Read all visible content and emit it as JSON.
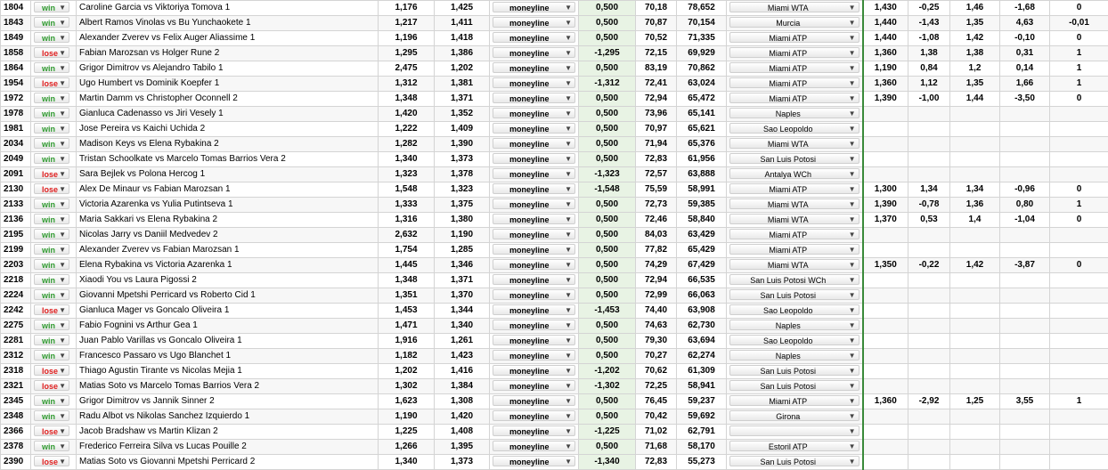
{
  "controls": {
    "arrow": "▼"
  },
  "rows": [
    {
      "id": "1804",
      "result": "win",
      "match": "Caroline Garcia  vs  Viktoriya Tomova 1",
      "o1": "1,176",
      "o2": "1,425",
      "type": "moneyline",
      "pl": "0,500",
      "p1": "70,18",
      "p2": "78,652",
      "venue": "Miami WTA",
      "g1": "1,430",
      "g2": "-0,25",
      "g3": "1,46",
      "g4": "-1,68",
      "g5": "0"
    },
    {
      "id": "1843",
      "result": "win",
      "match": "Albert Ramos Vinolas  vs  Bu Yunchaokete 1",
      "o1": "1,217",
      "o2": "1,411",
      "type": "moneyline",
      "pl": "0,500",
      "p1": "70,87",
      "p2": "70,154",
      "venue": "Murcia",
      "g1": "1,440",
      "g2": "-1,43",
      "g3": "1,35",
      "g4": "4,63",
      "g5": "-0,01"
    },
    {
      "id": "1849",
      "result": "win",
      "match": "Alexander Zverev  vs  Felix Auger Aliassime 1",
      "o1": "1,196",
      "o2": "1,418",
      "type": "moneyline",
      "pl": "0,500",
      "p1": "70,52",
      "p2": "71,335",
      "venue": "Miami ATP",
      "g1": "1,440",
      "g2": "-1,08",
      "g3": "1,42",
      "g4": "-0,10",
      "g5": "0"
    },
    {
      "id": "1858",
      "result": "lose",
      "match": "Fabian Marozsan  vs  Holger Rune 2",
      "o1": "1,295",
      "o2": "1,386",
      "type": "moneyline",
      "pl": "-1,295",
      "p1": "72,15",
      "p2": "69,929",
      "venue": "Miami ATP",
      "g1": "1,360",
      "g2": "1,38",
      "g3": "1,38",
      "g4": "0,31",
      "g5": "1"
    },
    {
      "id": "1864",
      "result": "win",
      "match": "Grigor Dimitrov  vs  Alejandro Tabilo 1",
      "o1": "2,475",
      "o2": "1,202",
      "type": "moneyline",
      "pl": "0,500",
      "p1": "83,19",
      "p2": "70,862",
      "venue": "Miami ATP",
      "g1": "1,190",
      "g2": "0,84",
      "g3": "1,2",
      "g4": "0,14",
      "g5": "1"
    },
    {
      "id": "1954",
      "result": "lose",
      "match": "Ugo Humbert  vs  Dominik Koepfer 1",
      "o1": "1,312",
      "o2": "1,381",
      "type": "moneyline",
      "pl": "-1,312",
      "p1": "72,41",
      "p2": "63,024",
      "venue": "Miami ATP",
      "g1": "1,360",
      "g2": "1,12",
      "g3": "1,35",
      "g4": "1,66",
      "g5": "1"
    },
    {
      "id": "1972",
      "result": "win",
      "match": "Martin Damm  vs  Christopher Oconnell 2",
      "o1": "1,348",
      "o2": "1,371",
      "type": "moneyline",
      "pl": "0,500",
      "p1": "72,94",
      "p2": "65,472",
      "venue": "Miami ATP",
      "g1": "1,390",
      "g2": "-1,00",
      "g3": "1,44",
      "g4": "-3,50",
      "g5": "0"
    },
    {
      "id": "1978",
      "result": "win",
      "match": "Gianluca Cadenasso  vs  Jiri Vesely 1",
      "o1": "1,420",
      "o2": "1,352",
      "type": "moneyline",
      "pl": "0,500",
      "p1": "73,96",
      "p2": "65,141",
      "venue": "Naples",
      "g1": "",
      "g2": "",
      "g3": "",
      "g4": "",
      "g5": ""
    },
    {
      "id": "1981",
      "result": "win",
      "match": "Jose Pereira  vs  Kaichi Uchida 2",
      "o1": "1,222",
      "o2": "1,409",
      "type": "moneyline",
      "pl": "0,500",
      "p1": "70,97",
      "p2": "65,621",
      "venue": "Sao Leopoldo",
      "g1": "",
      "g2": "",
      "g3": "",
      "g4": "",
      "g5": ""
    },
    {
      "id": "2034",
      "result": "win",
      "match": "Madison Keys  vs  Elena Rybakina 2",
      "o1": "1,282",
      "o2": "1,390",
      "type": "moneyline",
      "pl": "0,500",
      "p1": "71,94",
      "p2": "65,376",
      "venue": "Miami WTA",
      "g1": "",
      "g2": "",
      "g3": "",
      "g4": "",
      "g5": ""
    },
    {
      "id": "2049",
      "result": "win",
      "match": "Tristan Schoolkate  vs  Marcelo Tomas Barrios Vera 2",
      "o1": "1,340",
      "o2": "1,373",
      "type": "moneyline",
      "pl": "0,500",
      "p1": "72,83",
      "p2": "61,956",
      "venue": "San Luis Potosi",
      "g1": "",
      "g2": "",
      "g3": "",
      "g4": "",
      "g5": ""
    },
    {
      "id": "2091",
      "result": "lose",
      "match": "Sara Bejlek  vs  Polona Hercog 1",
      "o1": "1,323",
      "o2": "1,378",
      "type": "moneyline",
      "pl": "-1,323",
      "p1": "72,57",
      "p2": "63,888",
      "venue": "Antalya WCh",
      "g1": "",
      "g2": "",
      "g3": "",
      "g4": "",
      "g5": ""
    },
    {
      "id": "2130",
      "result": "lose",
      "match": "Alex De Minaur  vs  Fabian Marozsan 1",
      "o1": "1,548",
      "o2": "1,323",
      "type": "moneyline",
      "pl": "-1,548",
      "p1": "75,59",
      "p2": "58,991",
      "venue": "Miami ATP",
      "g1": "1,300",
      "g2": "1,34",
      "g3": "1,34",
      "g4": "-0,96",
      "g5": "0"
    },
    {
      "id": "2133",
      "result": "win",
      "match": "Victoria Azarenka  vs  Yulia Putintseva 1",
      "o1": "1,333",
      "o2": "1,375",
      "type": "moneyline",
      "pl": "0,500",
      "p1": "72,73",
      "p2": "59,385",
      "venue": "Miami WTA",
      "g1": "1,390",
      "g2": "-0,78",
      "g3": "1,36",
      "g4": "0,80",
      "g5": "1"
    },
    {
      "id": "2136",
      "result": "win",
      "match": "Maria Sakkari  vs  Elena Rybakina 2",
      "o1": "1,316",
      "o2": "1,380",
      "type": "moneyline",
      "pl": "0,500",
      "p1": "72,46",
      "p2": "58,840",
      "venue": "Miami WTA",
      "g1": "1,370",
      "g2": "0,53",
      "g3": "1,4",
      "g4": "-1,04",
      "g5": "0"
    },
    {
      "id": "2195",
      "result": "win",
      "match": "Nicolas Jarry  vs  Daniil Medvedev 2",
      "o1": "2,632",
      "o2": "1,190",
      "type": "moneyline",
      "pl": "0,500",
      "p1": "84,03",
      "p2": "63,429",
      "venue": "Miami ATP",
      "g1": "",
      "g2": "",
      "g3": "",
      "g4": "",
      "g5": ""
    },
    {
      "id": "2199",
      "result": "win",
      "match": "Alexander Zverev  vs  Fabian Marozsan 1",
      "o1": "1,754",
      "o2": "1,285",
      "type": "moneyline",
      "pl": "0,500",
      "p1": "77,82",
      "p2": "65,429",
      "venue": "Miami ATP",
      "g1": "",
      "g2": "",
      "g3": "",
      "g4": "",
      "g5": ""
    },
    {
      "id": "2203",
      "result": "win",
      "match": "Elena Rybakina  vs  Victoria Azarenka 1",
      "o1": "1,445",
      "o2": "1,346",
      "type": "moneyline",
      "pl": "0,500",
      "p1": "74,29",
      "p2": "67,429",
      "venue": "Miami WTA",
      "g1": "1,350",
      "g2": "-0,22",
      "g3": "1,42",
      "g4": "-3,87",
      "g5": "0"
    },
    {
      "id": "2218",
      "result": "win",
      "match": "Xiaodi You  vs  Laura Pigossi 2",
      "o1": "1,348",
      "o2": "1,371",
      "type": "moneyline",
      "pl": "0,500",
      "p1": "72,94",
      "p2": "66,535",
      "venue": "San Luis Potosi WCh",
      "g1": "",
      "g2": "",
      "g3": "",
      "g4": "",
      "g5": ""
    },
    {
      "id": "2224",
      "result": "win",
      "match": "Giovanni Mpetshi Perricard  vs  Roberto Cid 1",
      "o1": "1,351",
      "o2": "1,370",
      "type": "moneyline",
      "pl": "0,500",
      "p1": "72,99",
      "p2": "66,063",
      "venue": "San Luis Potosi",
      "g1": "",
      "g2": "",
      "g3": "",
      "g4": "",
      "g5": ""
    },
    {
      "id": "2242",
      "result": "lose",
      "match": "Gianluca Mager  vs  Goncalo Oliveira 1",
      "o1": "1,453",
      "o2": "1,344",
      "type": "moneyline",
      "pl": "-1,453",
      "p1": "74,40",
      "p2": "63,908",
      "venue": "Sao Leopoldo",
      "g1": "",
      "g2": "",
      "g3": "",
      "g4": "",
      "g5": ""
    },
    {
      "id": "2275",
      "result": "win",
      "match": "Fabio Fognini  vs  Arthur Gea 1",
      "o1": "1,471",
      "o2": "1,340",
      "type": "moneyline",
      "pl": "0,500",
      "p1": "74,63",
      "p2": "62,730",
      "venue": "Naples",
      "g1": "",
      "g2": "",
      "g3": "",
      "g4": "",
      "g5": ""
    },
    {
      "id": "2281",
      "result": "win",
      "match": "Juan Pablo Varillas  vs  Goncalo Oliveira 1",
      "o1": "1,916",
      "o2": "1,261",
      "type": "moneyline",
      "pl": "0,500",
      "p1": "79,30",
      "p2": "63,694",
      "venue": "Sao Leopoldo",
      "g1": "",
      "g2": "",
      "g3": "",
      "g4": "",
      "g5": ""
    },
    {
      "id": "2312",
      "result": "win",
      "match": " Francesco Passaro  vs  Ugo Blanchet 1",
      "o1": "1,182",
      "o2": "1,423",
      "type": "moneyline",
      "pl": "0,500",
      "p1": "70,27",
      "p2": "62,274",
      "venue": "Naples",
      "g1": "",
      "g2": "",
      "g3": "",
      "g4": "",
      "g5": ""
    },
    {
      "id": "2318",
      "result": "lose",
      "match": "Thiago Agustin Tirante  vs  Nicolas Mejia 1",
      "o1": "1,202",
      "o2": "1,416",
      "type": "moneyline",
      "pl": "-1,202",
      "p1": "70,62",
      "p2": "61,309",
      "venue": "San Luis Potosi",
      "g1": "",
      "g2": "",
      "g3": "",
      "g4": "",
      "g5": ""
    },
    {
      "id": "2321",
      "result": "lose",
      "match": "Matias Soto  vs  Marcelo Tomas Barrios Vera 2",
      "o1": "1,302",
      "o2": "1,384",
      "type": "moneyline",
      "pl": "-1,302",
      "p1": "72,25",
      "p2": "58,941",
      "venue": "San Luis Potosi",
      "g1": "",
      "g2": "",
      "g3": "",
      "g4": "",
      "g5": ""
    },
    {
      "id": "2345",
      "result": "win",
      "match": "Grigor Dimitrov  vs  Jannik Sinner 2",
      "o1": "1,623",
      "o2": "1,308",
      "type": "moneyline",
      "pl": "0,500",
      "p1": "76,45",
      "p2": "59,237",
      "venue": "Miami ATP",
      "g1": "1,360",
      "g2": "-2,92",
      "g3": "1,25",
      "g4": "3,55",
      "g5": "1"
    },
    {
      "id": "2348",
      "result": "win",
      "match": "Radu Albot  vs  Nikolas Sanchez Izquierdo 1",
      "o1": "1,190",
      "o2": "1,420",
      "type": "moneyline",
      "pl": "0,500",
      "p1": "70,42",
      "p2": "59,692",
      "venue": "Girona",
      "g1": "",
      "g2": "",
      "g3": "",
      "g4": "",
      "g5": ""
    },
    {
      "id": "2366",
      "result": "lose",
      "match": " Jacob Bradshaw  vs  Martin Klizan 2",
      "o1": "1,225",
      "o2": "1,408",
      "type": "moneyline",
      "pl": "-1,225",
      "p1": "71,02",
      "p2": "62,791",
      "venue": "",
      "g1": "",
      "g2": "",
      "g3": "",
      "g4": "",
      "g5": ""
    },
    {
      "id": "2378",
      "result": "win",
      "match": "Frederico Ferreira Silva  vs  Lucas Pouille 2",
      "o1": "1,266",
      "o2": "1,395",
      "type": "moneyline",
      "pl": "0,500",
      "p1": "71,68",
      "p2": "58,170",
      "venue": "Estoril ATP",
      "g1": "",
      "g2": "",
      "g3": "",
      "g4": "",
      "g5": ""
    },
    {
      "id": "2390",
      "result": "lose",
      "match": "Matias Soto  vs  Giovanni Mpetshi Perricard 2",
      "o1": "1,340",
      "o2": "1,373",
      "type": "moneyline",
      "pl": "-1,340",
      "p1": "72,83",
      "p2": "55,273",
      "venue": "San Luis Potosi",
      "g1": "",
      "g2": "",
      "g3": "",
      "g4": "",
      "g5": ""
    }
  ]
}
